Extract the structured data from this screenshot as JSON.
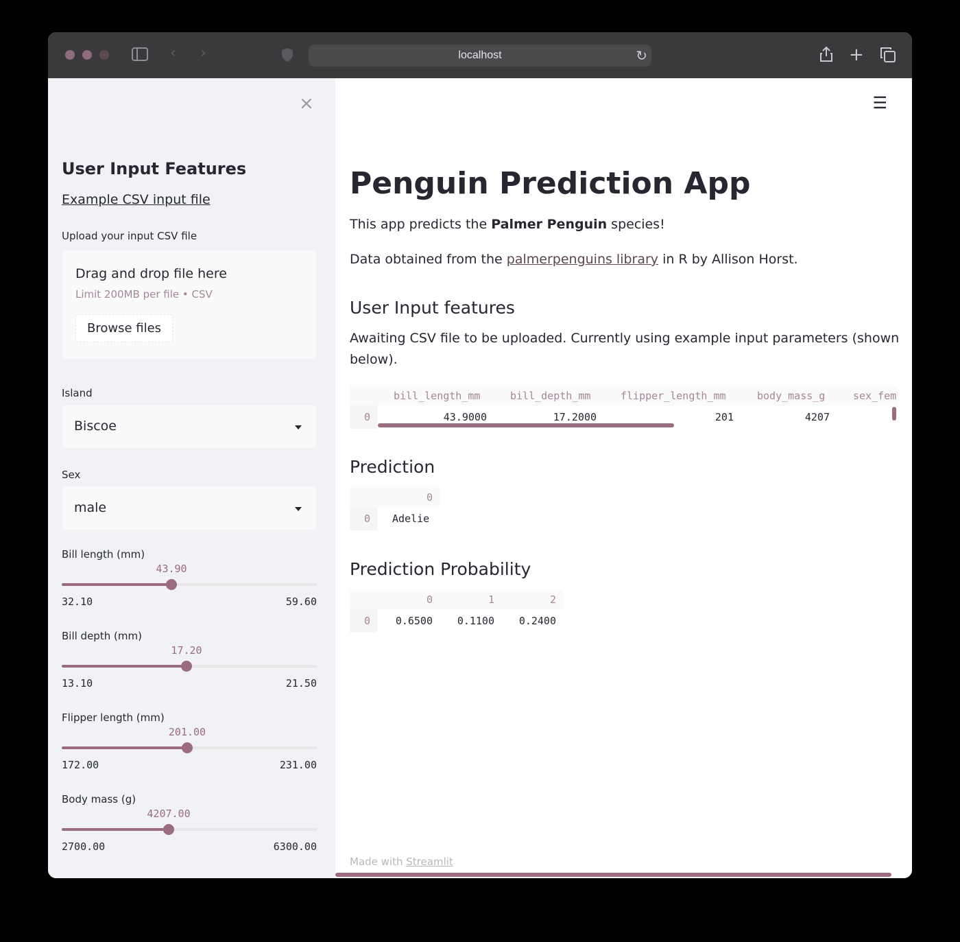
{
  "browser": {
    "url": "localhost",
    "colors": {
      "close": "#8f6d7d",
      "minimize": "#8f6d7d",
      "maximize": "#5a4a52"
    }
  },
  "sidebar": {
    "close_icon": "×",
    "title": "User Input Features",
    "example_link": "Example CSV input file",
    "upload_label": "Upload your input CSV file",
    "uploader": {
      "main": "Drag and drop file here",
      "sub": "Limit 200MB per file • CSV",
      "button": "Browse files"
    },
    "island": {
      "label": "Island",
      "value": "Biscoe"
    },
    "sex": {
      "label": "Sex",
      "value": "male"
    },
    "sliders": [
      {
        "label": "Bill length (mm)",
        "value": "43.90",
        "min": "32.10",
        "max": "59.60",
        "fraction": 0.429
      },
      {
        "label": "Bill depth (mm)",
        "value": "17.20",
        "min": "13.10",
        "max": "21.50",
        "fraction": 0.488
      },
      {
        "label": "Flipper length (mm)",
        "value": "201.00",
        "min": "172.00",
        "max": "231.00",
        "fraction": 0.492
      },
      {
        "label": "Body mass (g)",
        "value": "4207.00",
        "min": "2700.00",
        "max": "6300.00",
        "fraction": 0.419
      }
    ]
  },
  "main": {
    "menu_icon": "☰",
    "title": "Penguin Prediction App",
    "intro_pre": "This app predicts the ",
    "intro_bold": "Palmer Penguin",
    "intro_post": " species!",
    "data_pre": "Data obtained from the ",
    "data_link": "palmerpenguins library",
    "data_post": " in R by Allison Horst.",
    "input_heading": "User Input features",
    "awaiting_line1": "Awaiting CSV file to be uploaded. Currently using example input parameters (shown",
    "awaiting_line2": "below).",
    "input_table": {
      "columns": [
        "bill_length_mm",
        "bill_depth_mm",
        "flipper_length_mm",
        "body_mass_g",
        "sex_fem"
      ],
      "index": "0",
      "row": [
        "43.9000",
        "17.2000",
        "201",
        "4207",
        ""
      ]
    },
    "prediction_heading": "Prediction",
    "prediction_table": {
      "column": "0",
      "index": "0",
      "value": "Adelie"
    },
    "probability_heading": "Prediction Probability",
    "probability_table": {
      "columns": [
        "0",
        "1",
        "2"
      ],
      "index": "0",
      "row": [
        "0.6500",
        "0.1100",
        "0.2400"
      ]
    },
    "footer_pre": "Made with ",
    "footer_link": "Streamlit"
  }
}
